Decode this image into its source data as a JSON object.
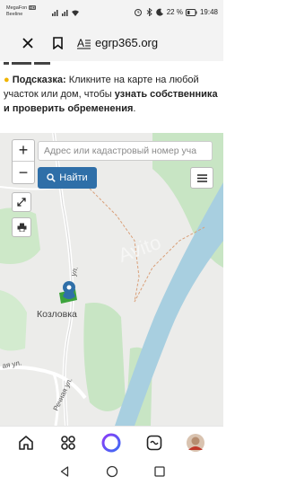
{
  "status": {
    "carrier_line1": "MegaFon",
    "carrier_hd": "HD",
    "carrier_line2": "Beeline",
    "battery": "22 %",
    "time": "19:48"
  },
  "browser": {
    "url": "egrp365.org"
  },
  "hint": {
    "prefix": "Подсказка:",
    "text1": " Кликните на карте на любой участок или дом, чтобы ",
    "bold": "узнать собственника и проверить обременения",
    "text2": "."
  },
  "map": {
    "zoom_in": "+",
    "zoom_out": "−",
    "search_placeholder": "Адрес или кадастровый номер уча",
    "find_label": "Найти",
    "town": "Козловка",
    "street_ul": "ул.",
    "street_aya": "ая ул.",
    "street_rechnaya": "Речная ул."
  },
  "colors": {
    "accent": "#2f6fa8",
    "river": "#a8cfe0",
    "forest": "#c8e5c4",
    "marker": "#2f6fa8",
    "parcel": "#3ca43c"
  }
}
